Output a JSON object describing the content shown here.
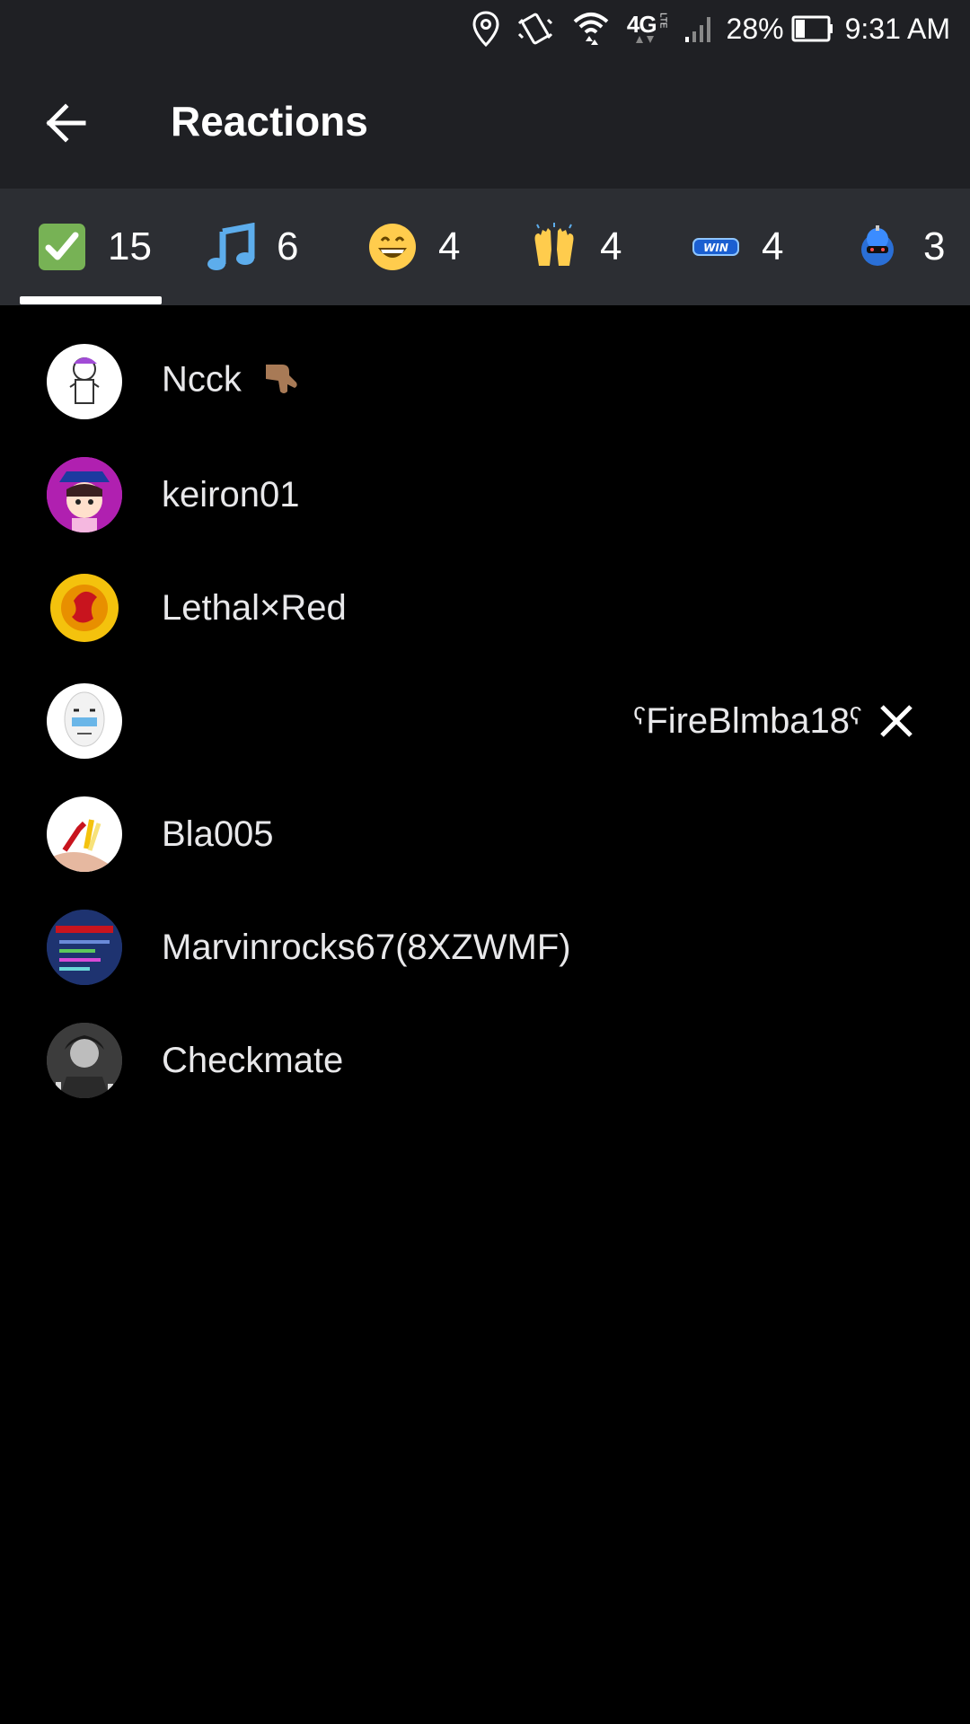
{
  "status_bar": {
    "battery": "28%",
    "time": "9:31 AM",
    "network": "4G",
    "network_sub": "LTE",
    "icons": [
      "location-icon",
      "vibrate-icon",
      "wifi-icon",
      "signal-icon",
      "battery-icon"
    ]
  },
  "header": {
    "back_icon": "arrow-left-icon",
    "title": "Reactions"
  },
  "tabs": [
    {
      "emoji": "check-mark-button",
      "count": "15",
      "selected": true
    },
    {
      "emoji": "musical-note",
      "count": "6"
    },
    {
      "emoji": "grinning-face",
      "count": "4"
    },
    {
      "emoji": "raising-hands",
      "count": "4"
    },
    {
      "emoji": "win-badge",
      "count": "4",
      "emoji_text": "WIN"
    },
    {
      "emoji": "robot-avatar",
      "count": "3"
    }
  ],
  "users": [
    {
      "name": "Ncck",
      "badge": "thumbs-down-emoji"
    },
    {
      "name": "keiron01"
    },
    {
      "name": "Lethal×Red"
    },
    {
      "name": "ˁFireBlmba18ˁ",
      "removable": true
    },
    {
      "name": "Bla005"
    },
    {
      "name": "Marvinrocks67(8XZWMF)"
    },
    {
      "name": "Checkmate"
    }
  ],
  "colors": {
    "background": "#000000",
    "header": "#1f2024",
    "tab_bar": "#2c2e33",
    "text": "#e8e8ea",
    "accent_green": "#77b255",
    "note_blue": "#5dadec",
    "emoji_yellow": "#ffcc4d"
  }
}
